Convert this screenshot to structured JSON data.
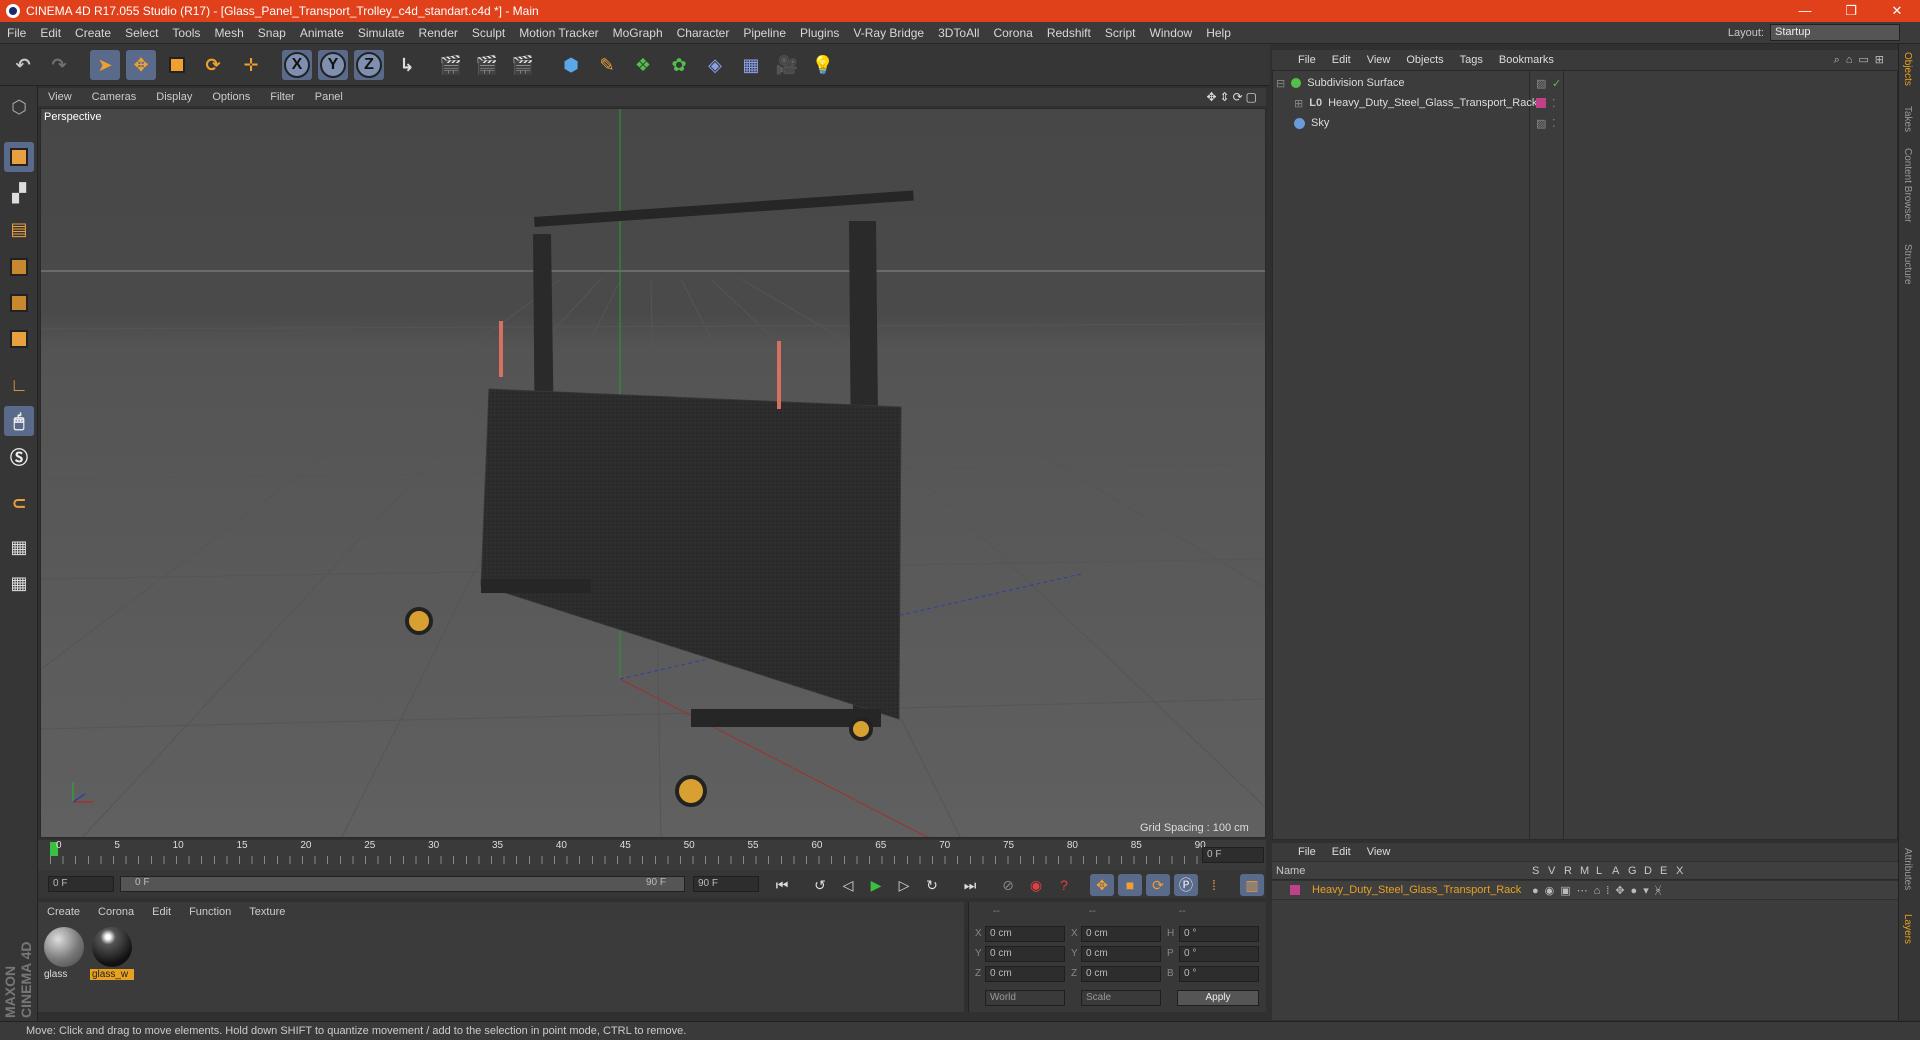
{
  "window": {
    "title": "CINEMA 4D R17.055 Studio (R17) - [Glass_Panel_Transport_Trolley_c4d_standart.c4d *] - Main",
    "minimize": "—",
    "restore": "❐",
    "close": "✕"
  },
  "menu": [
    "File",
    "Edit",
    "Create",
    "Select",
    "Tools",
    "Mesh",
    "Snap",
    "Animate",
    "Simulate",
    "Render",
    "Sculpt",
    "Motion Tracker",
    "MoGraph",
    "Character",
    "Pipeline",
    "Plugins",
    "V-Ray Bridge",
    "3DToAll",
    "Corona",
    "Redshift",
    "Script",
    "Window",
    "Help"
  ],
  "layout": {
    "label": "Layout:",
    "value": "Startup"
  },
  "toolbar": {
    "undo_icon": "undo-icon",
    "redo_icon": "redo-icon",
    "axis_x": "X",
    "axis_y": "Y",
    "axis_z": "Z"
  },
  "viewport": {
    "menu": [
      "View",
      "Cameras",
      "Display",
      "Options",
      "Filter",
      "Panel"
    ],
    "label": "Perspective",
    "grid_spacing": "Grid Spacing : 100 cm"
  },
  "timeline": {
    "ticks": [
      "0",
      "5",
      "10",
      "15",
      "20",
      "25",
      "30",
      "35",
      "40",
      "45",
      "50",
      "55",
      "60",
      "65",
      "70",
      "75",
      "80",
      "85",
      "90"
    ],
    "current_frame": "0 F",
    "start_field": "0 F",
    "range_start": "0 F",
    "range_end": "90 F",
    "end_field": "90 F"
  },
  "materials": {
    "menu": [
      "Create",
      "Corona",
      "Edit",
      "Function",
      "Texture"
    ],
    "items": [
      {
        "name": "glass"
      },
      {
        "name": "glass_w"
      }
    ]
  },
  "coords": {
    "header": [
      "--",
      "--",
      "--"
    ],
    "rows": [
      {
        "a": "X",
        "av": "0 cm",
        "b": "X",
        "bv": "0 cm",
        "c": "H",
        "cv": "0 °"
      },
      {
        "a": "Y",
        "av": "0 cm",
        "b": "Y",
        "bv": "0 cm",
        "c": "P",
        "cv": "0 °"
      },
      {
        "a": "Z",
        "av": "0 cm",
        "b": "Z",
        "bv": "0 cm",
        "c": "B",
        "cv": "0 °"
      }
    ],
    "world": "World",
    "scale": "Scale",
    "apply": "Apply"
  },
  "objects": {
    "menu": [
      "File",
      "Edit",
      "View",
      "Objects",
      "Tags",
      "Bookmarks"
    ],
    "items": [
      {
        "name": "Subdivision Surface",
        "color": "#52c04a"
      },
      {
        "name": "Heavy_Duty_Steel_Glass_Transport_Rack",
        "color": "#d8d8d8"
      },
      {
        "name": "Sky",
        "color": "#6a9ad8"
      }
    ]
  },
  "layers": {
    "menu": [
      "File",
      "Edit",
      "View"
    ],
    "columns": [
      "Name",
      "S",
      "V",
      "R",
      "M",
      "L",
      "A",
      "G",
      "D",
      "E",
      "X"
    ],
    "items": [
      {
        "name": "Heavy_Duty_Steel_Glass_Transport_Rack",
        "color": "#c0408a"
      }
    ]
  },
  "righttabs": [
    "Objects",
    "Takes",
    "Content Browser",
    "Structure",
    "Attributes",
    "Layers"
  ],
  "status": "Move: Click and drag to move elements. Hold down SHIFT to quantize movement / add to the selection in point mode, CTRL to remove.",
  "brand": "MAXON CINEMA 4D"
}
